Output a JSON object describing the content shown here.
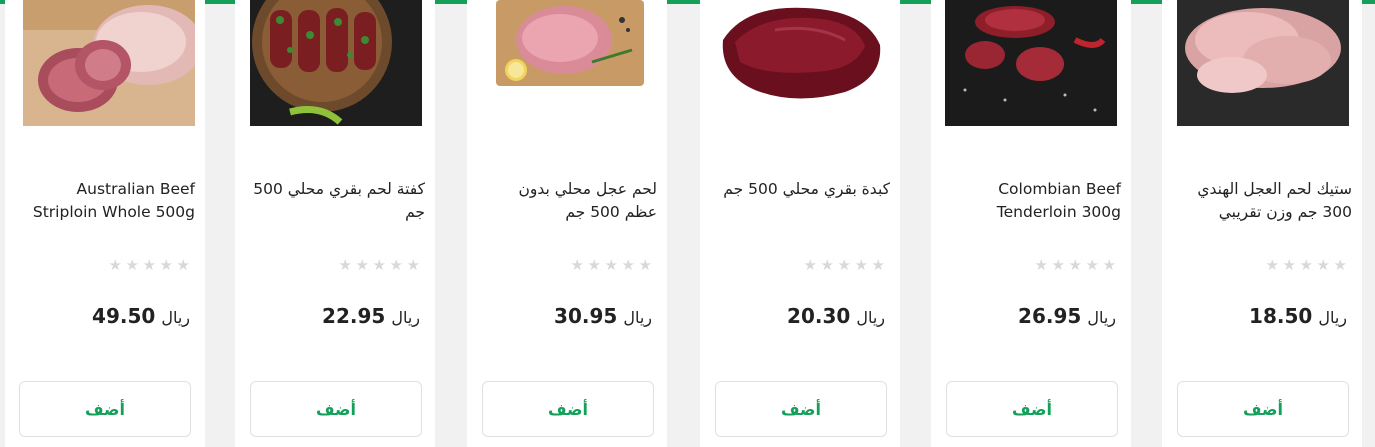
{
  "products": [
    {
      "name": "Australian Beef Striploin Whole 500g",
      "currency": "ريال",
      "price": "49.50",
      "add_label": "أضف",
      "rating": 0,
      "image": "raw-striploin-image"
    },
    {
      "name": "كفتة لحم بقري محلي 500 جم",
      "currency": "ريال",
      "price": "22.95",
      "add_label": "أضف",
      "rating": 0,
      "image": "kofta-skewers-image"
    },
    {
      "name": "لحم عجل محلي بدون عظم 500 جم",
      "currency": "ريال",
      "price": "30.95",
      "add_label": "أضف",
      "rating": 0,
      "image": "boneless-veal-image"
    },
    {
      "name": "كبدة بقري محلي 500 جم",
      "currency": "ريال",
      "price": "20.30",
      "add_label": "أضف",
      "rating": 0,
      "image": "beef-liver-image"
    },
    {
      "name": "Colombian Beef Tenderloin 300g",
      "currency": "ريال",
      "price": "26.95",
      "add_label": "أضف",
      "rating": 0,
      "image": "tenderloin-image"
    },
    {
      "name": "ستيك لحم العجل الهندي 300 جم وزن تقريبي",
      "currency": "ريال",
      "price": "18.50",
      "add_label": "أضف",
      "rating": 0,
      "image": "veal-steak-image"
    }
  ],
  "colors": {
    "accent": "#14a05a"
  }
}
